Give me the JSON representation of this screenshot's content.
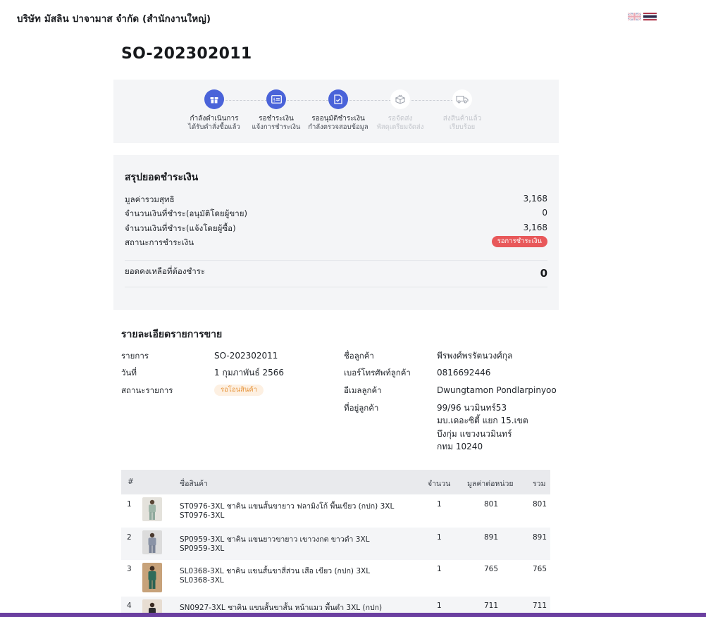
{
  "company": {
    "name": "บริษัท มัสลิน ปาจามาส จำกัด (สำนักงานใหญ่)"
  },
  "languages": [
    {
      "name": "English",
      "icon": "uk-flag-icon"
    },
    {
      "name": "Thai",
      "icon": "thai-flag-icon"
    }
  ],
  "order": {
    "number": "SO-202302011"
  },
  "steps": [
    {
      "title": "กำลังดำเนินการ",
      "subtitle": "ได้รับคำสั่งซื้อแล้ว",
      "icon": "gift-box-icon",
      "active": true
    },
    {
      "title": "รอชำระเงิน",
      "subtitle": "แจ้งการชำระเงิน",
      "icon": "payment-card-icon",
      "active": true
    },
    {
      "title": "รออนุมัติชำระเงิน",
      "subtitle": "กำลังตรวจสอบข้อมูล",
      "icon": "document-check-icon",
      "active": true
    },
    {
      "title": "รอจัดส่ง",
      "subtitle": "พัสดุเตรียมจัดส่ง",
      "icon": "package-icon",
      "active": false
    },
    {
      "title": "ส่งสินค้าแล้ว",
      "subtitle": "เรียบร้อย",
      "icon": "delivery-truck-icon",
      "active": false
    }
  ],
  "summary": {
    "title": "สรุปยอดชำระเงิน",
    "net_total_label": "มูลค่ารวมสุทธิ",
    "net_total": "3,168",
    "paid_seller_label": "จำนวนเงินที่ชำระ(อนุมัติโดยผู้ขาย)",
    "paid_seller": "0",
    "paid_buyer_label": "จำนวนเงินที่ชำระ(แจ้งโดยผู้ซื้อ)",
    "paid_buyer": "3,168",
    "payment_status_label": "สถานะการชำระเงิน",
    "payment_status": "รอการชำระเงิน",
    "payment_status_color": "#e8585a",
    "balance_label": "ยอดคงเหลือที่ต้องชำระ",
    "balance": "0"
  },
  "details": {
    "title": "รายละเอียดรายการขาย",
    "order_label": "รายการ",
    "order_value": "SO-202302011",
    "date_label": "วันที่",
    "date_value": "1 กุมภาพันธ์ 2566",
    "status_label": "สถานะรายการ",
    "status_value": "รอโอนสินค้า",
    "status_color": "#e7953c",
    "customer_label": "ชื่อลูกค้า",
    "customer_value": "พีรพงศ์พรรัตนวงศ์กุล",
    "phone_label": "เบอร์โทรศัพท์ลูกค้า",
    "phone_value": "0816692446",
    "email_label": "อีเมลลูกค้า",
    "email_value": "Dwungtamon Pondlarpinyoo",
    "address_label": "ที่อยู่ลูกค้า",
    "address_lines": [
      "99/96 นวมินทร์53",
      "มบ.เดอะซิตี้ แยก 15.เขต",
      "บึงกุ่ม แขวงนวมินทร์",
      "กทม 10240"
    ]
  },
  "items_table": {
    "headers": {
      "index": "#",
      "name": "ชื่อสินค้า",
      "qty": "จำนวน",
      "unit_price": "มูลค่าต่อหน่วย",
      "total": "รวม"
    },
    "rows": [
      {
        "index": "1",
        "name": "ST0976-3XL ชาคิน แขนสั้นขายาว ฟลามิงโก้ พื้นเขียว (กปก) 3XL",
        "sku": "ST0976-3XL",
        "qty": "1",
        "unit_price": "801",
        "total": "801"
      },
      {
        "index": "2",
        "name": "SP0959-3XL ชาคิน แขนยาวขายาว เขาวงกต ขาวดำ 3XL",
        "sku": "SP0959-3XL",
        "qty": "1",
        "unit_price": "891",
        "total": "891"
      },
      {
        "index": "3",
        "name": "SL0368-3XL ชาคิน แขนสั้นขาสี่ส่วน เสือ เขียว (กปก) 3XL",
        "sku": "SL0368-3XL",
        "qty": "1",
        "unit_price": "765",
        "total": "765"
      },
      {
        "index": "4",
        "name": "SN0927-3XL ชาคิน แขนสั้นขาสั้น หน้าแมว พื้นดำ 3XL (กปก)",
        "sku": "",
        "qty": "1",
        "unit_price": "711",
        "total": "711"
      }
    ]
  },
  "colors": {
    "accent": "#4a63d9",
    "bottom_bar": "#6b3fa0"
  }
}
